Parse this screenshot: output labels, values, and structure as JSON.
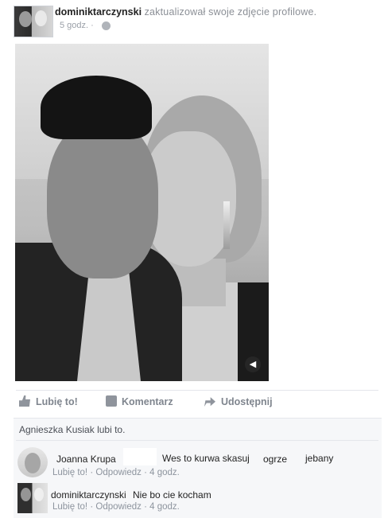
{
  "post": {
    "author": "dominiktarczynski",
    "action": "zaktualizował swoje zdjęcie profilowe.",
    "time": "5 godz. ·",
    "privacy_icon": "globe-icon",
    "photo_icon": "sound-icon"
  },
  "actions": {
    "like": "Lubię to!",
    "comment": "Komentarz",
    "share": "Udostępnij"
  },
  "likes": {
    "name": "Agnieszka Kusiak",
    "suffix": "lubi to."
  },
  "comments": [
    {
      "author": "Joanna Krupa",
      "text_parts": [
        "Wes to kurwa skasuj",
        "ogrze",
        "jebany"
      ],
      "like_label": "Lubię to!",
      "separator": "·",
      "reply_label": "Odpowiedz",
      "time": "· 4 godz."
    },
    {
      "author": "dominiktarczynski",
      "text": "Nie bo cie kocham",
      "like_label": "Lubię to!",
      "separator": "·",
      "reply_label": "Odpowiedz",
      "time": "· 4 godz."
    }
  ]
}
